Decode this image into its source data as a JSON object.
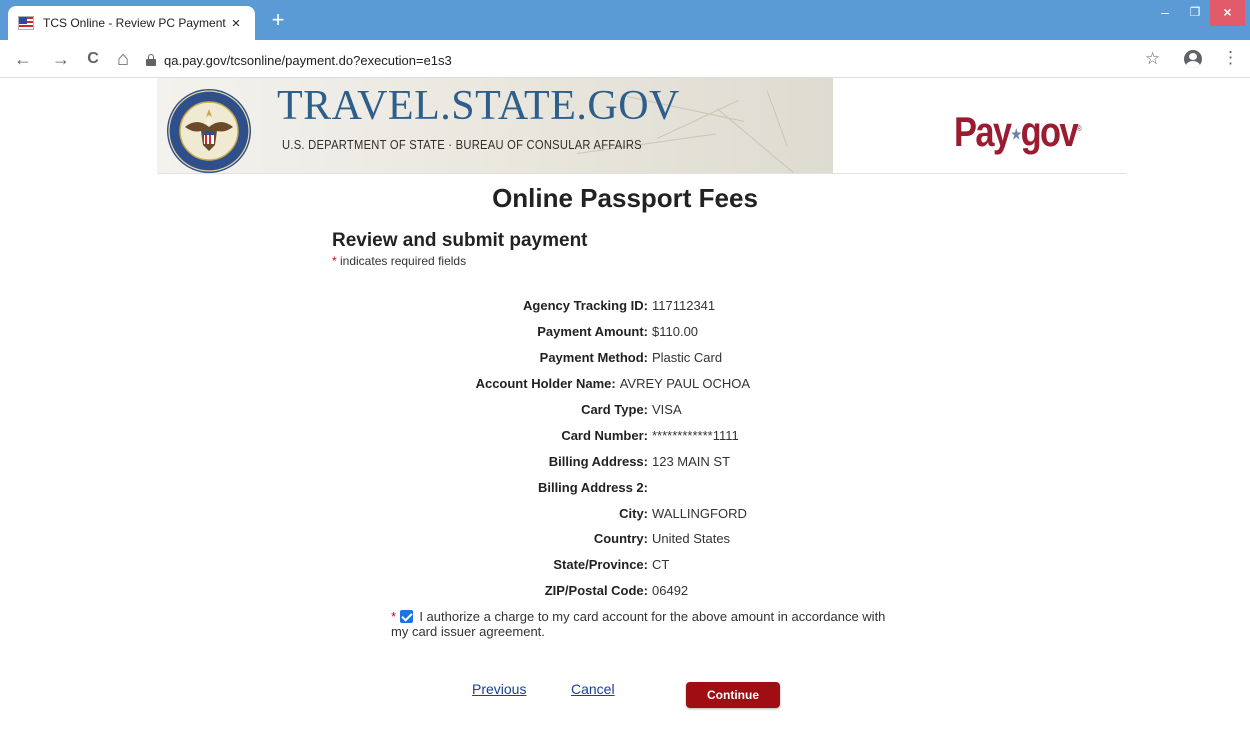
{
  "browser": {
    "tab_title": "TCS Online - Review PC Payment",
    "tab_close": "×",
    "new_tab": "+",
    "url": "qa.pay.gov/tcsonline/payment.do?execution=e1s3",
    "window": {
      "minimize": "–",
      "maximize": "❐",
      "close": "×"
    },
    "nav": {
      "back": "←",
      "forward": "→",
      "reload": "C",
      "home": "⌂"
    },
    "star": "☆",
    "menu": "⋮"
  },
  "header": {
    "site_title": "TRAVEL.STATE.GOV",
    "site_subtitle": "U.S. DEPARTMENT OF STATE · BUREAU OF CONSULAR AFFAIRS",
    "paygov_left": "Pay",
    "paygov_right": "gov",
    "paygov_star": "★",
    "paygov_reg": "®"
  },
  "page": {
    "title": "Online Passport Fees",
    "section_heading": "Review and submit payment",
    "required_star": "*",
    "required_note": " indicates required fields"
  },
  "details": [
    {
      "label": "Agency Tracking ID:",
      "value": "117112341"
    },
    {
      "label": "Payment Amount:",
      "value": "$110.00"
    },
    {
      "label": "Payment Method:",
      "value": "Plastic Card"
    },
    {
      "label": "Account Holder Name:",
      "value": "AVREY PAUL OCHOA"
    },
    {
      "label": "Card Type:",
      "value": "VISA"
    },
    {
      "label": "Card Number:",
      "value": "************1111"
    },
    {
      "label": "Billing Address:",
      "value": "123 MAIN ST"
    },
    {
      "label": "Billing Address 2:",
      "value": ""
    },
    {
      "label": "City:",
      "value": "WALLINGFORD"
    },
    {
      "label": "Country:",
      "value": "United States"
    },
    {
      "label": "State/Province:",
      "value": "CT"
    },
    {
      "label": "ZIP/Postal Code:",
      "value": "06492"
    }
  ],
  "authorization": {
    "required_star": "*",
    "checked": true,
    "text": "I authorize a charge to my card account for the above amount in accordance with my card issuer agreement."
  },
  "actions": {
    "previous": "Previous",
    "cancel": "Cancel",
    "continue": "Continue"
  },
  "colors": {
    "tabstrip": "#5a9bd5",
    "brand_blue": "#2d5f8a",
    "paygov_red": "#9b1b30",
    "continue_button": "#a00d12",
    "link": "#1a3e9c"
  }
}
